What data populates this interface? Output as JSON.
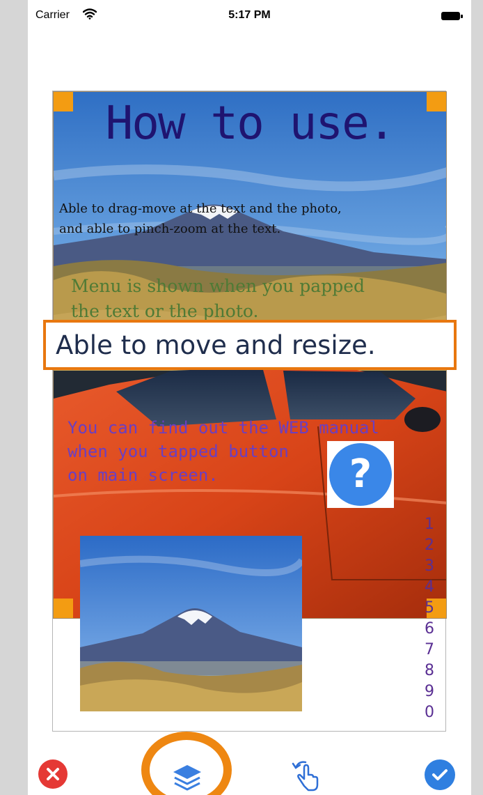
{
  "status_bar": {
    "carrier": "Carrier",
    "time": "5:17 PM",
    "wifi_icon": "wifi-icon",
    "battery_icon": "battery-icon"
  },
  "canvas": {
    "title": "How to use.",
    "body_lines": [
      "Able to drag-move at the text and the photo,",
      "and able to pinch-zoom at the text."
    ],
    "green_lines": [
      "Menu is shown when you papped",
      "the text or the photo."
    ],
    "resize_label": "Able to move and resize.",
    "purple_lines": [
      "You can find out the WEB manual",
      "when you tapped button",
      "on main screen."
    ],
    "help_symbol": "?",
    "vertical_numbers": [
      "1",
      "2",
      "3",
      "4",
      "5",
      "6",
      "7",
      "8",
      "9",
      "0"
    ]
  },
  "toolbar": {
    "cancel_icon": "close-icon",
    "layers_icon": "layers-icon",
    "touch_icon": "touch-gesture-icon",
    "done_icon": "checkmark-icon"
  },
  "colors": {
    "handle": "#f39c12",
    "highlight": "#e8770f",
    "title": "#1f1470",
    "cancel": "#e53935",
    "done": "#2f7fe0",
    "help": "#3a87e8"
  }
}
